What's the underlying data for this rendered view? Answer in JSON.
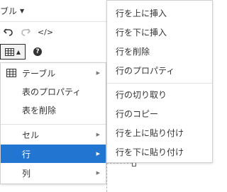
{
  "menubar": {
    "table_menu_label": "ブル"
  },
  "toolbar": {
    "undo_icon": "undo-icon",
    "redo_icon": "redo-icon",
    "code_icon": "code-icon",
    "code_glyph": "</>",
    "table_icon": "table-icon",
    "help_icon": "help-icon",
    "help_glyph": "?"
  },
  "table_menu": {
    "items": [
      {
        "label": "テーブル",
        "icon": "table-icon",
        "has_submenu": true
      },
      {
        "label": "表のプロパティ",
        "has_submenu": false
      },
      {
        "label": "表を削除",
        "has_submenu": false
      },
      {
        "label": "セル",
        "has_submenu": true
      },
      {
        "label": "行",
        "has_submenu": true,
        "active": true
      },
      {
        "label": "列",
        "has_submenu": true
      }
    ]
  },
  "row_submenu": {
    "items": [
      {
        "label": "行を上に挿入"
      },
      {
        "label": "行を下に挿入"
      },
      {
        "label": "行を削除"
      },
      {
        "label": "行のプロパティ"
      },
      {
        "label": "行の切り取り"
      },
      {
        "label": "行のコピー"
      },
      {
        "label": "行を上に貼り付け"
      },
      {
        "label": "行を下に貼り付け"
      }
    ]
  },
  "colors": {
    "active_item_bg": "#2276d2",
    "active_item_text": "#ffffff",
    "menu_border": "#d0d0d0"
  }
}
